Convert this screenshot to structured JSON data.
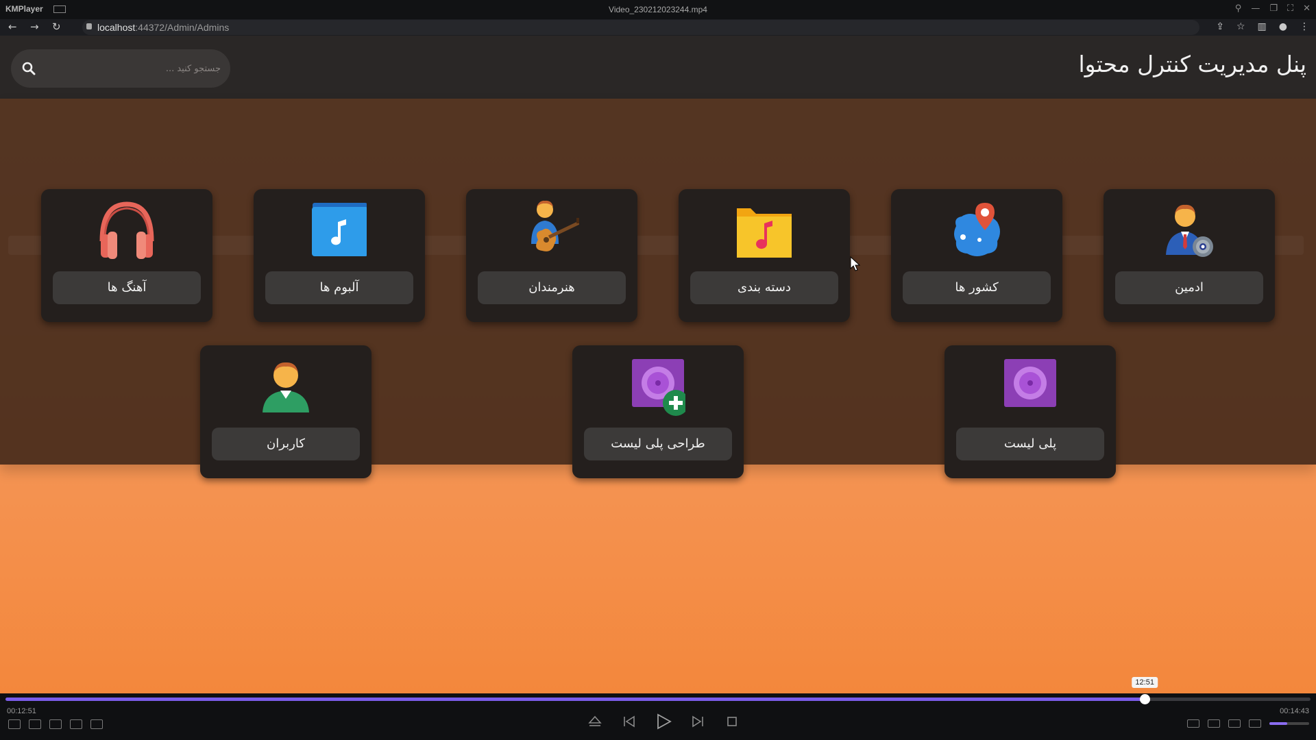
{
  "player": {
    "app_name": "KMPlayer",
    "file_name": "Video_230212023244.mp4",
    "current_time": "00:12:51",
    "total_time": "00:14:43",
    "tooltip_time": "12:51",
    "progress": 0.873,
    "volume": 0.45,
    "accent_color": "#7b5ce8"
  },
  "browser": {
    "url_host": "localhost",
    "url_rest": ":44372/Admin/Admins"
  },
  "header": {
    "title": "پنل مدیریت کنترل محتوا",
    "search_placeholder": "جستجو کنید ..."
  },
  "cards": [
    {
      "label": "ادمین",
      "icon": "admin-gear-icon"
    },
    {
      "label": "کشور ها",
      "icon": "map-pin-icon"
    },
    {
      "label": "دسته بندی",
      "icon": "music-folder-icon"
    },
    {
      "label": "هنرمندان",
      "icon": "guitarist-icon"
    },
    {
      "label": "آلبوم ها",
      "icon": "music-album-icon"
    },
    {
      "label": "آهنگ ها",
      "icon": "headphones-icon"
    },
    {
      "label": "پلی لیست",
      "icon": "playlist-disc-icon"
    },
    {
      "label": "طراحی پلی لیست",
      "icon": "playlist-add-icon"
    },
    {
      "label": "کاربران",
      "icon": "user-icon"
    }
  ]
}
